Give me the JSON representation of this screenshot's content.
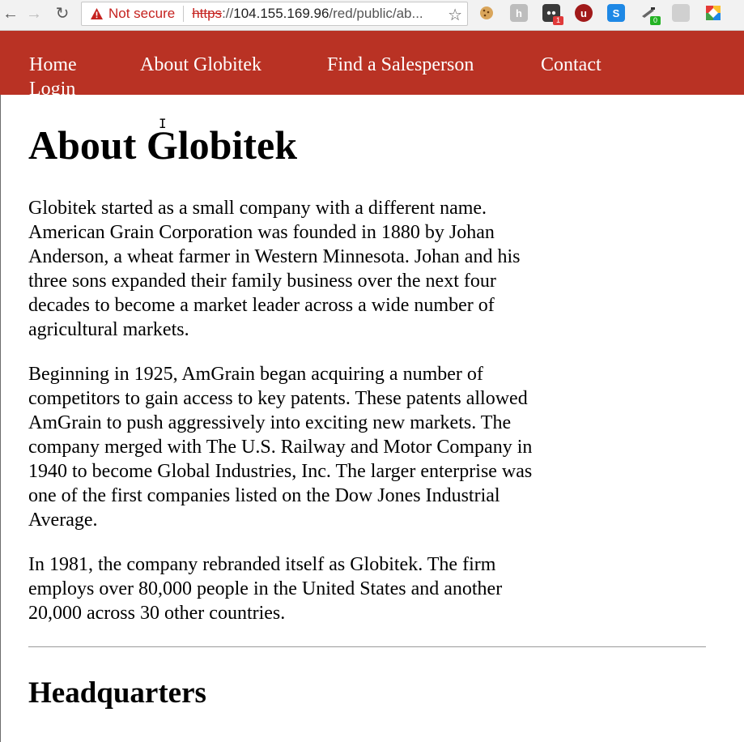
{
  "browser": {
    "back_icon": "←",
    "forward_icon": "→",
    "reload_icon": "↻",
    "security_text": "Not secure",
    "url_scheme": "https",
    "url_sep": "://",
    "url_host": "104.155.169.96",
    "url_path": "/red/public/ab...",
    "star_icon": "☆",
    "extensions": [
      {
        "name": "cookie-ext-icon",
        "glyph": "🍪",
        "badge": ""
      },
      {
        "name": "h-ext-icon",
        "glyph": "h",
        "badge": ""
      },
      {
        "name": "ghost-ext-icon",
        "glyph": "●",
        "badge": "1"
      },
      {
        "name": "ublock-ext-icon",
        "glyph": "u",
        "badge": ""
      },
      {
        "name": "s-ext-icon",
        "glyph": "S",
        "badge": ""
      },
      {
        "name": "tool-ext-icon",
        "glyph": "✎",
        "badge": "0"
      },
      {
        "name": "gray-ext-icon",
        "glyph": "▭",
        "badge": ""
      },
      {
        "name": "chrome-ext-icon",
        "glyph": "◆",
        "badge": ""
      }
    ],
    "colors": {
      "warning": "#c5221f",
      "chrome_bg": "#f2f2f2"
    }
  },
  "nav": {
    "links": [
      "Home",
      "About Globitek",
      "Find a Salesperson",
      "Contact",
      "Login"
    ],
    "color": "#b93224"
  },
  "main": {
    "title": "About Globitek",
    "paragraphs": [
      "Globitek started as a small company with a different name. American Grain Corporation was founded in 1880 by Johan Anderson, a wheat farmer in Western Minnesota. Johan and his three sons expanded their family business over the next four decades to become a market leader across a wide number of agricultural markets.",
      "Beginning in 1925, AmGrain began acquiring a number of competitors to gain access to key patents. These patents allowed AmGrain to push aggressively into exciting new markets. The company merged with The U.S. Railway and Motor Company in 1940 to become Global Industries, Inc. The larger enterprise was one of the first companies listed on the Dow Jones Industrial Average.",
      "In 1981, the company rebranded itself as Globitek. The firm employs over 80,000 people in the United States and another 20,000 across 30 other countries."
    ],
    "section_heading": "Headquarters"
  }
}
